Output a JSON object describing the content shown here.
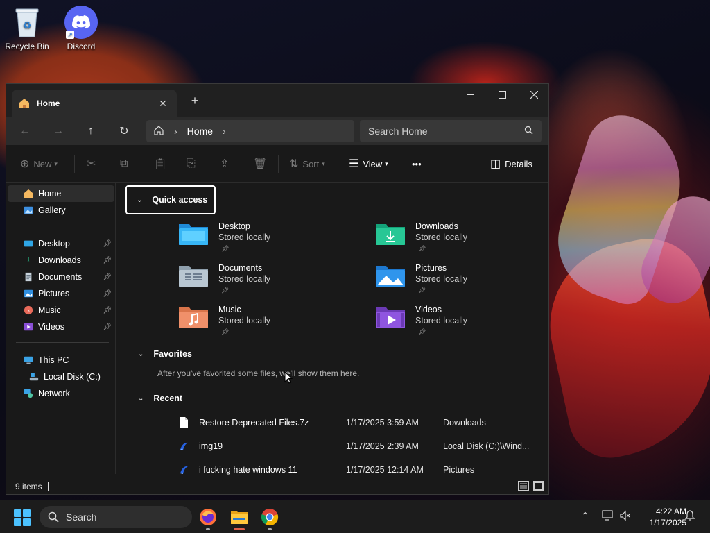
{
  "desktop": {
    "icons": [
      {
        "label": "Recycle Bin"
      },
      {
        "label": "Discord"
      }
    ]
  },
  "window": {
    "tab_title": "Home",
    "new_tab": "+",
    "controls": {
      "minimize": "—",
      "maximize": "☐",
      "close": "✕"
    }
  },
  "navbar": {
    "breadcrumb": "Home",
    "search_placeholder": "Search Home"
  },
  "commandbar": {
    "new": "New",
    "sort": "Sort",
    "view": "View",
    "more": "•••",
    "details": "Details"
  },
  "sidebar": {
    "items": [
      {
        "label": "Home"
      },
      {
        "label": "Gallery"
      },
      {
        "label": "Desktop"
      },
      {
        "label": "Downloads"
      },
      {
        "label": "Documents"
      },
      {
        "label": "Pictures"
      },
      {
        "label": "Music"
      },
      {
        "label": "Videos"
      },
      {
        "label": "This PC"
      },
      {
        "label": "Local Disk (C:)"
      },
      {
        "label": "Network"
      }
    ]
  },
  "quick_access": {
    "title": "Quick access",
    "folders": [
      {
        "name": "Desktop",
        "sub": "Stored locally"
      },
      {
        "name": "Downloads",
        "sub": "Stored locally"
      },
      {
        "name": "Documents",
        "sub": "Stored locally"
      },
      {
        "name": "Pictures",
        "sub": "Stored locally"
      },
      {
        "name": "Music",
        "sub": "Stored locally"
      },
      {
        "name": "Videos",
        "sub": "Stored locally"
      }
    ]
  },
  "favorites": {
    "title": "Favorites",
    "empty_note": "After you've favorited some files, we'll show them here."
  },
  "recent": {
    "title": "Recent",
    "rows": [
      {
        "name": "Restore Deprecated Files.7z",
        "date": "1/17/2025 3:59 AM",
        "location": "Downloads"
      },
      {
        "name": "img19",
        "date": "1/17/2025 2:39 AM",
        "location": "Local Disk (C:)\\Wind..."
      },
      {
        "name": "i fucking hate windows 11",
        "date": "1/17/2025 12:14 AM",
        "location": "Pictures"
      }
    ]
  },
  "status": {
    "items_count": "9 items"
  },
  "taskbar": {
    "search_placeholder": "Search",
    "time": "4:22 AM",
    "date": "1/17/2025"
  },
  "colors": {
    "accent": "#4cc2ff",
    "window_bg": "#191919",
    "taskbar_bg": "#1c1c1c"
  }
}
